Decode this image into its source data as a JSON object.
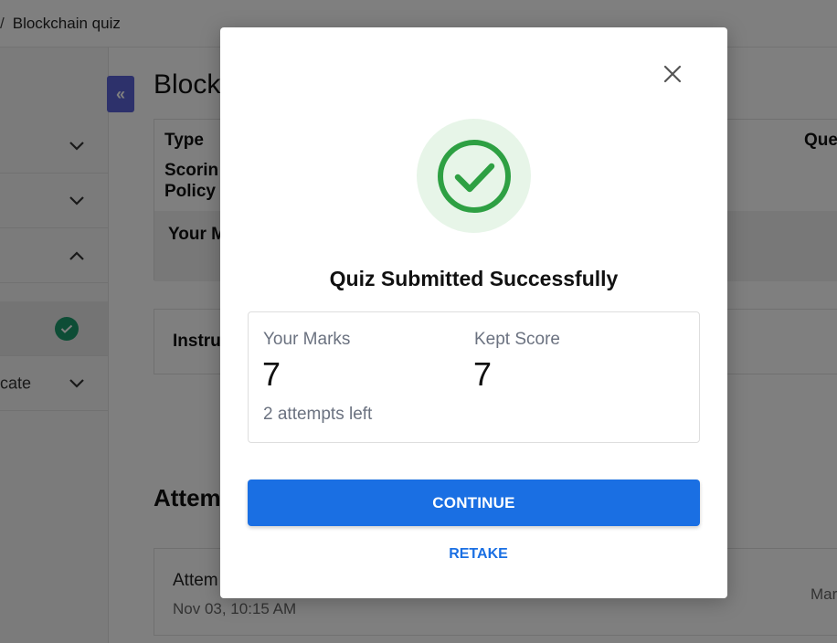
{
  "breadcrumb": {
    "separator": "/",
    "current": "Blockchain quiz"
  },
  "sidebar": {
    "items": [
      {
        "label": "",
        "state": "collapsed"
      },
      {
        "label": "",
        "state": "collapsed"
      },
      {
        "label": "",
        "state": "expanded"
      },
      {
        "label": "",
        "state": "completed"
      },
      {
        "label": "cate",
        "state": "collapsed"
      }
    ],
    "collapse_label": "«"
  },
  "main": {
    "title": "Block",
    "info": {
      "type_label": "Type",
      "scoring_label_1": "Scorin",
      "scoring_label_2": "Policy",
      "marks_label": "Your M",
      "questions_label": "Que"
    },
    "instructions_label": "Instru",
    "attempts_title": "Attem",
    "attempt": {
      "name": "Attem",
      "date": "Nov 03, 10:15 AM",
      "right_text": "Mar"
    }
  },
  "modal": {
    "title": "Quiz Submitted Successfully",
    "your_marks_label": "Your Marks",
    "your_marks_value": "7",
    "kept_score_label": "Kept Score",
    "kept_score_value": "7",
    "attempts_left": "2 attempts left",
    "continue_label": "CONTINUE",
    "retake_label": "RETAKE",
    "icons": {
      "close": "close-icon",
      "success": "check-circle-icon"
    }
  },
  "colors": {
    "primary": "#1a6fe3",
    "success": "#2ea043",
    "success_bg": "#e7f5e8",
    "completed_badge": "#1d9b6c",
    "collapse_button": "#5b63d6"
  }
}
